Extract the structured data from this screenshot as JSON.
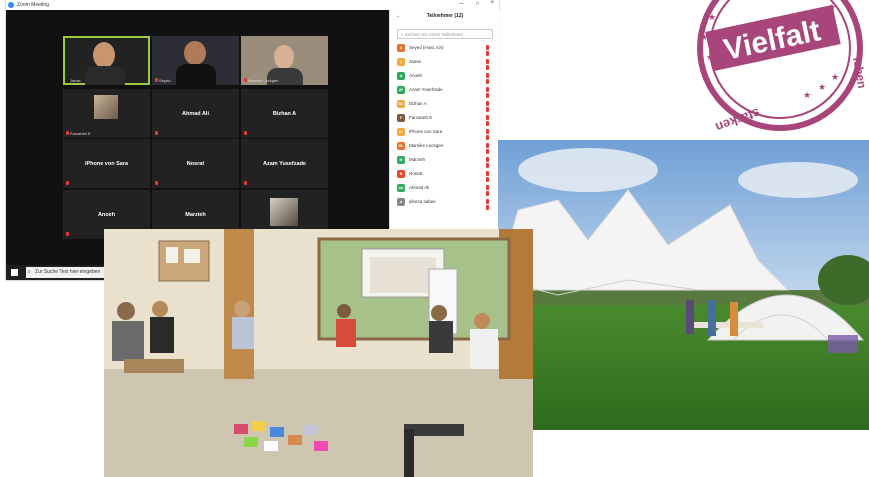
{
  "zoom": {
    "title": "Zoom Meeting",
    "tiles": [
      {
        "name": "Jamie",
        "type": "video"
      },
      {
        "name": "Seyed",
        "type": "video"
      },
      {
        "name": "Mareike Lockgen",
        "type": "video"
      },
      {
        "name": "Farzaneh E",
        "type": "photo"
      },
      {
        "name": "Ahmad Ali",
        "type": "name"
      },
      {
        "name": "Bizhan A",
        "type": "name"
      },
      {
        "name": "iPhone von Sara",
        "type": "name"
      },
      {
        "name": "Nosrat",
        "type": "name"
      },
      {
        "name": "Azam Yusefzade",
        "type": "name"
      },
      {
        "name": "Anoeh",
        "type": "name"
      },
      {
        "name": "Marzieh",
        "type": "name"
      },
      {
        "name": "",
        "type": "photo"
      }
    ],
    "participants_panel": {
      "title": "Teilnehmer (12)",
      "search_placeholder": "Suchen Sie einen Teilnehmer",
      "participants": [
        {
          "initial": "S",
          "name": "Seyed (Host, ich)",
          "color": "#e8712d"
        },
        {
          "initial": "J",
          "name": "Jamie",
          "color": "#f2a93b"
        },
        {
          "initial": "A",
          "name": "Anoeh",
          "color": "#2eaa5c"
        },
        {
          "initial": "AY",
          "name": "Azam Yusefzade",
          "color": "#2eaa5c"
        },
        {
          "initial": "BA",
          "name": "Bizhan A",
          "color": "#f2a93b"
        },
        {
          "initial": "F",
          "name": "Farzaneh E",
          "color": "#7a5c3c"
        },
        {
          "initial": "iV",
          "name": "iPhone von Sara",
          "color": "#f2a93b"
        },
        {
          "initial": "ML",
          "name": "Mareike Lockgen",
          "color": "#e8712d"
        },
        {
          "initial": "M",
          "name": "Marzieh",
          "color": "#2eaa5c"
        },
        {
          "initial": "N",
          "name": "Nosrat",
          "color": "#e8472d"
        },
        {
          "initial": "AA",
          "name": "Ahmad Ali",
          "color": "#2eaa5c"
        },
        {
          "initial": "a",
          "name": "alireza safaei",
          "color": "#888888"
        }
      ]
    },
    "taskbar_search": "Zur Suche Text hier eingeben"
  },
  "stamp": {
    "main_word": "Vielfalt",
    "side_word": "leben",
    "bottom_word": "stärken",
    "color": "#a8457a"
  }
}
